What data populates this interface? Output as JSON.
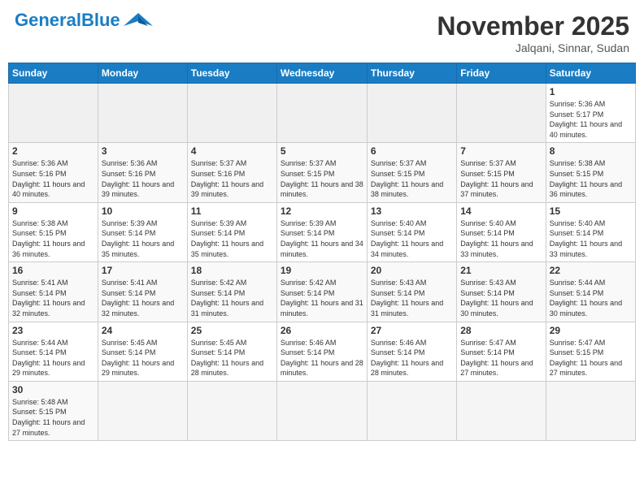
{
  "header": {
    "logo_general": "General",
    "logo_blue": "Blue",
    "month_title": "November 2025",
    "location": "Jalqani, Sinnar, Sudan"
  },
  "days_of_week": [
    "Sunday",
    "Monday",
    "Tuesday",
    "Wednesday",
    "Thursday",
    "Friday",
    "Saturday"
  ],
  "weeks": [
    {
      "cells": [
        {
          "day": "",
          "info": ""
        },
        {
          "day": "",
          "info": ""
        },
        {
          "day": "",
          "info": ""
        },
        {
          "day": "",
          "info": ""
        },
        {
          "day": "",
          "info": ""
        },
        {
          "day": "",
          "info": ""
        },
        {
          "day": "1",
          "info": "Sunrise: 5:36 AM\nSunset: 5:17 PM\nDaylight: 11 hours and 40 minutes."
        }
      ]
    },
    {
      "cells": [
        {
          "day": "2",
          "info": "Sunrise: 5:36 AM\nSunset: 5:16 PM\nDaylight: 11 hours and 40 minutes."
        },
        {
          "day": "3",
          "info": "Sunrise: 5:36 AM\nSunset: 5:16 PM\nDaylight: 11 hours and 39 minutes."
        },
        {
          "day": "4",
          "info": "Sunrise: 5:37 AM\nSunset: 5:16 PM\nDaylight: 11 hours and 39 minutes."
        },
        {
          "day": "5",
          "info": "Sunrise: 5:37 AM\nSunset: 5:15 PM\nDaylight: 11 hours and 38 minutes."
        },
        {
          "day": "6",
          "info": "Sunrise: 5:37 AM\nSunset: 5:15 PM\nDaylight: 11 hours and 38 minutes."
        },
        {
          "day": "7",
          "info": "Sunrise: 5:37 AM\nSunset: 5:15 PM\nDaylight: 11 hours and 37 minutes."
        },
        {
          "day": "8",
          "info": "Sunrise: 5:38 AM\nSunset: 5:15 PM\nDaylight: 11 hours and 36 minutes."
        }
      ]
    },
    {
      "cells": [
        {
          "day": "9",
          "info": "Sunrise: 5:38 AM\nSunset: 5:15 PM\nDaylight: 11 hours and 36 minutes."
        },
        {
          "day": "10",
          "info": "Sunrise: 5:39 AM\nSunset: 5:14 PM\nDaylight: 11 hours and 35 minutes."
        },
        {
          "day": "11",
          "info": "Sunrise: 5:39 AM\nSunset: 5:14 PM\nDaylight: 11 hours and 35 minutes."
        },
        {
          "day": "12",
          "info": "Sunrise: 5:39 AM\nSunset: 5:14 PM\nDaylight: 11 hours and 34 minutes."
        },
        {
          "day": "13",
          "info": "Sunrise: 5:40 AM\nSunset: 5:14 PM\nDaylight: 11 hours and 34 minutes."
        },
        {
          "day": "14",
          "info": "Sunrise: 5:40 AM\nSunset: 5:14 PM\nDaylight: 11 hours and 33 minutes."
        },
        {
          "day": "15",
          "info": "Sunrise: 5:40 AM\nSunset: 5:14 PM\nDaylight: 11 hours and 33 minutes."
        }
      ]
    },
    {
      "cells": [
        {
          "day": "16",
          "info": "Sunrise: 5:41 AM\nSunset: 5:14 PM\nDaylight: 11 hours and 32 minutes."
        },
        {
          "day": "17",
          "info": "Sunrise: 5:41 AM\nSunset: 5:14 PM\nDaylight: 11 hours and 32 minutes."
        },
        {
          "day": "18",
          "info": "Sunrise: 5:42 AM\nSunset: 5:14 PM\nDaylight: 11 hours and 31 minutes."
        },
        {
          "day": "19",
          "info": "Sunrise: 5:42 AM\nSunset: 5:14 PM\nDaylight: 11 hours and 31 minutes."
        },
        {
          "day": "20",
          "info": "Sunrise: 5:43 AM\nSunset: 5:14 PM\nDaylight: 11 hours and 31 minutes."
        },
        {
          "day": "21",
          "info": "Sunrise: 5:43 AM\nSunset: 5:14 PM\nDaylight: 11 hours and 30 minutes."
        },
        {
          "day": "22",
          "info": "Sunrise: 5:44 AM\nSunset: 5:14 PM\nDaylight: 11 hours and 30 minutes."
        }
      ]
    },
    {
      "cells": [
        {
          "day": "23",
          "info": "Sunrise: 5:44 AM\nSunset: 5:14 PM\nDaylight: 11 hours and 29 minutes."
        },
        {
          "day": "24",
          "info": "Sunrise: 5:45 AM\nSunset: 5:14 PM\nDaylight: 11 hours and 29 minutes."
        },
        {
          "day": "25",
          "info": "Sunrise: 5:45 AM\nSunset: 5:14 PM\nDaylight: 11 hours and 28 minutes."
        },
        {
          "day": "26",
          "info": "Sunrise: 5:46 AM\nSunset: 5:14 PM\nDaylight: 11 hours and 28 minutes."
        },
        {
          "day": "27",
          "info": "Sunrise: 5:46 AM\nSunset: 5:14 PM\nDaylight: 11 hours and 28 minutes."
        },
        {
          "day": "28",
          "info": "Sunrise: 5:47 AM\nSunset: 5:14 PM\nDaylight: 11 hours and 27 minutes."
        },
        {
          "day": "29",
          "info": "Sunrise: 5:47 AM\nSunset: 5:15 PM\nDaylight: 11 hours and 27 minutes."
        }
      ]
    },
    {
      "cells": [
        {
          "day": "30",
          "info": "Sunrise: 5:48 AM\nSunset: 5:15 PM\nDaylight: 11 hours and 27 minutes."
        },
        {
          "day": "",
          "info": ""
        },
        {
          "day": "",
          "info": ""
        },
        {
          "day": "",
          "info": ""
        },
        {
          "day": "",
          "info": ""
        },
        {
          "day": "",
          "info": ""
        },
        {
          "day": "",
          "info": ""
        }
      ]
    }
  ]
}
